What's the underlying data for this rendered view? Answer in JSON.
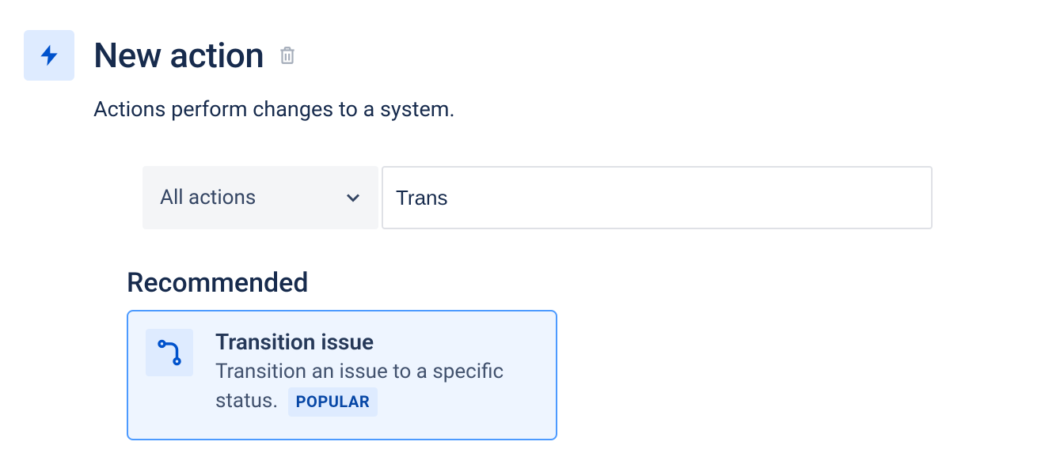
{
  "header": {
    "title": "New action",
    "subtitle": "Actions perform changes to a system."
  },
  "filter": {
    "dropdown_label": "All actions",
    "search_value": "Trans"
  },
  "recommended": {
    "heading": "Recommended",
    "card": {
      "title": "Transition issue",
      "description": "Transition an issue to a specific status.",
      "badge": "POPULAR"
    }
  }
}
